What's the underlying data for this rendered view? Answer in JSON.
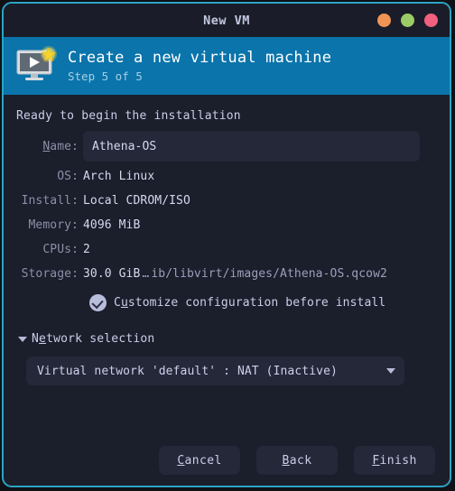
{
  "window": {
    "title": "New VM",
    "controls": [
      {
        "name": "minimize",
        "color": "#f09455"
      },
      {
        "name": "maximize",
        "color": "#9ccc65"
      },
      {
        "name": "close",
        "color": "#f2607f"
      }
    ],
    "border_color": "#2aa4c4"
  },
  "header": {
    "icon": "virtual-machine-new-icon",
    "title": "Create a new virtual machine",
    "subtitle": "Step 5 of 5",
    "accent_color": "#0a74ab"
  },
  "main": {
    "ready_text": "Ready to begin the installation",
    "name_field": {
      "label_pre": "N",
      "label_mnemonic": "N",
      "label": "Name:",
      "label_rest": "ame:",
      "value": "Athena-OS",
      "placeholder": ""
    },
    "summary_rows": [
      {
        "label": "OS:",
        "value": "Arch Linux"
      },
      {
        "label": "Install:",
        "value": "Local CDROM/ISO"
      },
      {
        "label": "Memory:",
        "value": "4096 MiB"
      },
      {
        "label": "CPUs:",
        "value": "2"
      }
    ],
    "storage_row": {
      "label": "Storage:",
      "size": "30.0 GiB",
      "ellipsis": "…",
      "path": "ib/libvirt/images/Athena-OS.qcow2"
    },
    "customize_checkbox": {
      "checked": true,
      "label_pre": "C",
      "label_mnemonic": "u",
      "label_post": "stomize configuration before install"
    },
    "network_expander": {
      "expanded": true,
      "label_pre": "N",
      "label_mnemonic": "e",
      "label_post": "twork selection"
    },
    "network_combo": {
      "value": "Virtual network 'default' : NAT (Inactive)"
    }
  },
  "footer": {
    "buttons": [
      {
        "name": "cancel",
        "mnemonic": "C",
        "rest": "ancel"
      },
      {
        "name": "back",
        "mnemonic": "B",
        "rest": "ack"
      },
      {
        "name": "finish",
        "mnemonic": "F",
        "rest": "inish"
      }
    ]
  }
}
